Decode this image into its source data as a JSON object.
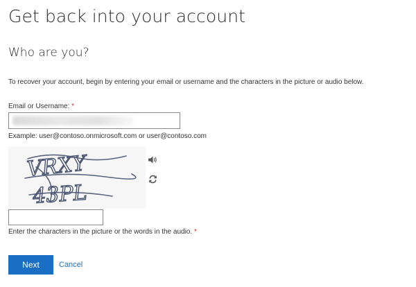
{
  "page": {
    "title": "Get back into your account",
    "subtitle": "Who are you?",
    "intro": "To recover your account, begin by entering your email or username and the characters in the picture or audio below."
  },
  "email": {
    "label": "Email or Username:",
    "required_mark": "*",
    "value": "",
    "example": "Example: user@contoso.onmicrosoft.com or user@contoso.com"
  },
  "captcha": {
    "image_text_line1": "VRXY",
    "image_text_line2": "43PL",
    "audio_icon": "speaker-icon",
    "refresh_icon": "refresh-icon",
    "input_value": "",
    "label": "Enter the characters in the picture or the words in the audio.",
    "required_mark": "*"
  },
  "actions": {
    "next_label": "Next",
    "cancel_label": "Cancel"
  },
  "colors": {
    "primary": "#1a6fc4",
    "required": "#c0392b",
    "text": "#333333",
    "captcha_ink": "#4a5570"
  }
}
